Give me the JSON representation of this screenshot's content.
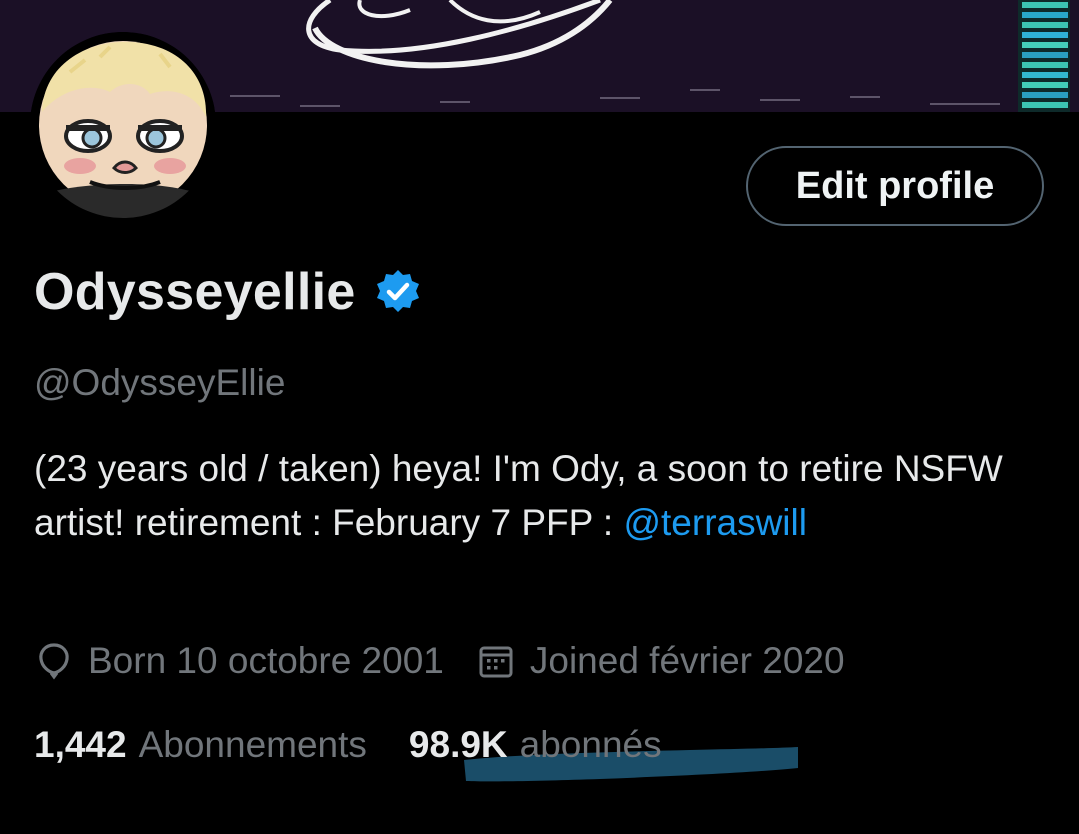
{
  "profile": {
    "display_name": "Odysseyellie",
    "handle": "@OdysseyEllie",
    "bio_text": "(23 years old / taken) heya! I'm Ody, a soon to retire NSFW artist! retirement : February 7  PFP : ",
    "bio_mention": "@terraswill",
    "birth": "Born 10 octobre 2001",
    "joined": "Joined février 2020"
  },
  "actions": {
    "edit_profile_label": "Edit profile"
  },
  "stats": {
    "following_count": "1,442",
    "following_label": "Abonnements",
    "followers_count": "98.9K",
    "followers_label": "abonnés"
  },
  "icons": {
    "verified": "verified-badge-icon",
    "birth": "balloon-icon",
    "joined": "calendar-icon"
  },
  "colors": {
    "background": "#000000",
    "text_primary": "#e7e9ea",
    "text_secondary": "#71767b",
    "accent": "#1d9bf0",
    "highlight_marker": "#1f5a7a"
  }
}
